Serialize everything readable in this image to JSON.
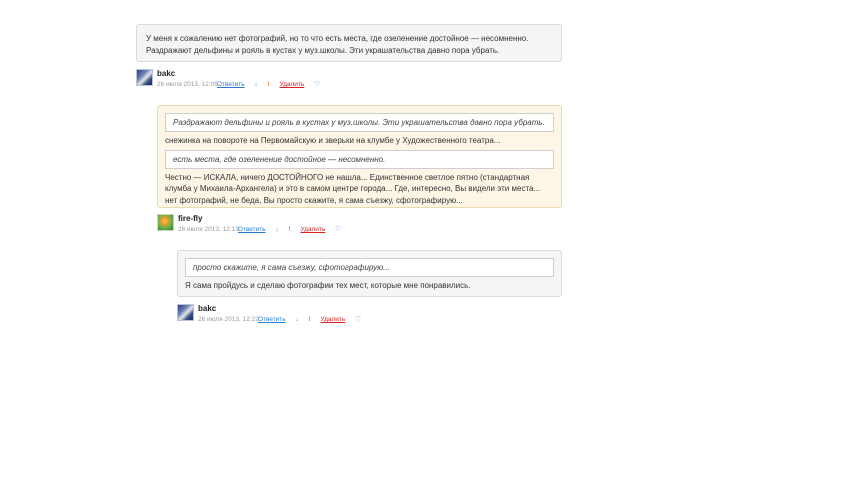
{
  "comment1": {
    "text": "У меня к сожалению нет фотографий, но то что есть места, где озеленение достойное — несомненно. Раздражают дельфины и рояль в кустах у муз.школы. Эти украшательства давно пора убрать."
  },
  "author1": {
    "name": "bakc",
    "date": "26 июля 2013, 12:05",
    "reply_label": "Ответить",
    "down_icon": "↓",
    "flag_icon": "!",
    "delete_label": "Удалить",
    "heart_icon": "♡"
  },
  "comment2": {
    "quote1": "Раздражают дельфины и рояль в кустах у муз.школы. Эти украшательства давно пора убрать.",
    "text1": "снежинка на повороте на Первомайскую и зверьки на клумбе у Художественного театра...",
    "quote2": "есть места, где озеленение достойное — несомненно.",
    "text2": "Честно — ИСКАЛА, ничего ДОСТОЙНОГО не нашла... Единственное светлое пятно (стандартная клумба у Михаила-Архангела) и это в самом центре города... Где, интересно, Вы видели эти места... нет фотографий, не беда, Вы просто скажите, я сама съезжу, сфотографирую..."
  },
  "author2": {
    "name": "fire-fly",
    "date": "26 июля 2013, 12:13",
    "reply_label": "Ответить",
    "down_icon": "↓",
    "flag_icon": "!",
    "delete_label": "Удалить",
    "heart_icon": "♡"
  },
  "comment3": {
    "quote1": "просто скажите, я сама съезжу, сфотографирую...",
    "text1": "Я сама пройдусь и сделаю фотографии тех мест, которые мне понравились."
  },
  "author3": {
    "name": "bakc",
    "date": "26 июля 2013, 12:22",
    "reply_label": "Ответить",
    "down_icon": "↓",
    "flag_icon": "!",
    "delete_label": "Удалить",
    "heart_icon": "♡"
  }
}
